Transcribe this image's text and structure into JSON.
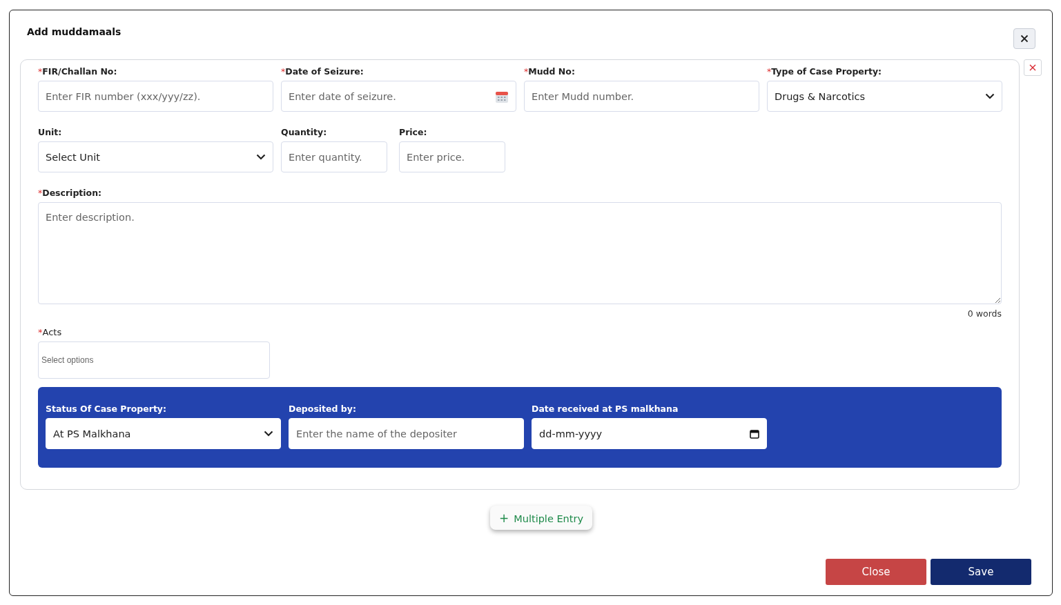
{
  "dialog": {
    "title": "Add muddamaals"
  },
  "entry": {
    "rows": [
      [
        {
          "label": "FIR/Challan No:",
          "required_mark": "*",
          "kind": "text",
          "placeholder": "Enter FIR number (xxx/yyy/zz)."
        },
        {
          "label": "Date of Seizure:",
          "required_mark": "*",
          "kind": "date",
          "placeholder": "Enter date of seizure."
        },
        {
          "label": "Mudd No:",
          "required_mark": "*",
          "kind": "text",
          "placeholder": "Enter Mudd number."
        },
        {
          "label": "Type of Case Property:",
          "required_mark": "*",
          "kind": "select",
          "value": "Drugs & Narcotics"
        }
      ],
      [
        {
          "label": "Unit:",
          "kind": "select",
          "value": "Select Unit"
        },
        {
          "label": "Quantity:",
          "kind": "number",
          "placeholder": "Enter quantity."
        },
        {
          "label": "Price:",
          "kind": "number",
          "placeholder": "Enter price."
        }
      ]
    ],
    "description": {
      "label": "Description:",
      "required_mark": "*",
      "placeholder": "Enter description.",
      "word_count": "0 words"
    },
    "acts": {
      "label": "Acts",
      "required_mark": "*",
      "placeholder": "Select options"
    },
    "status_panel": [
      {
        "label": "Status Of Case Property:",
        "kind": "select",
        "value": "At PS Malkhana"
      },
      {
        "label": "Deposited by:",
        "kind": "text",
        "placeholder": "Enter the name of the depositer"
      },
      {
        "label": "Date received at PS malkhana",
        "kind": "nativedate",
        "value": "dd-mm-yyyy"
      }
    ]
  },
  "add_button": {
    "icon": "+",
    "label": "Multiple Entry"
  },
  "footer_buttons": [
    {
      "label": "Close",
      "kind": "close"
    },
    {
      "label": "Save",
      "kind": "save"
    }
  ]
}
